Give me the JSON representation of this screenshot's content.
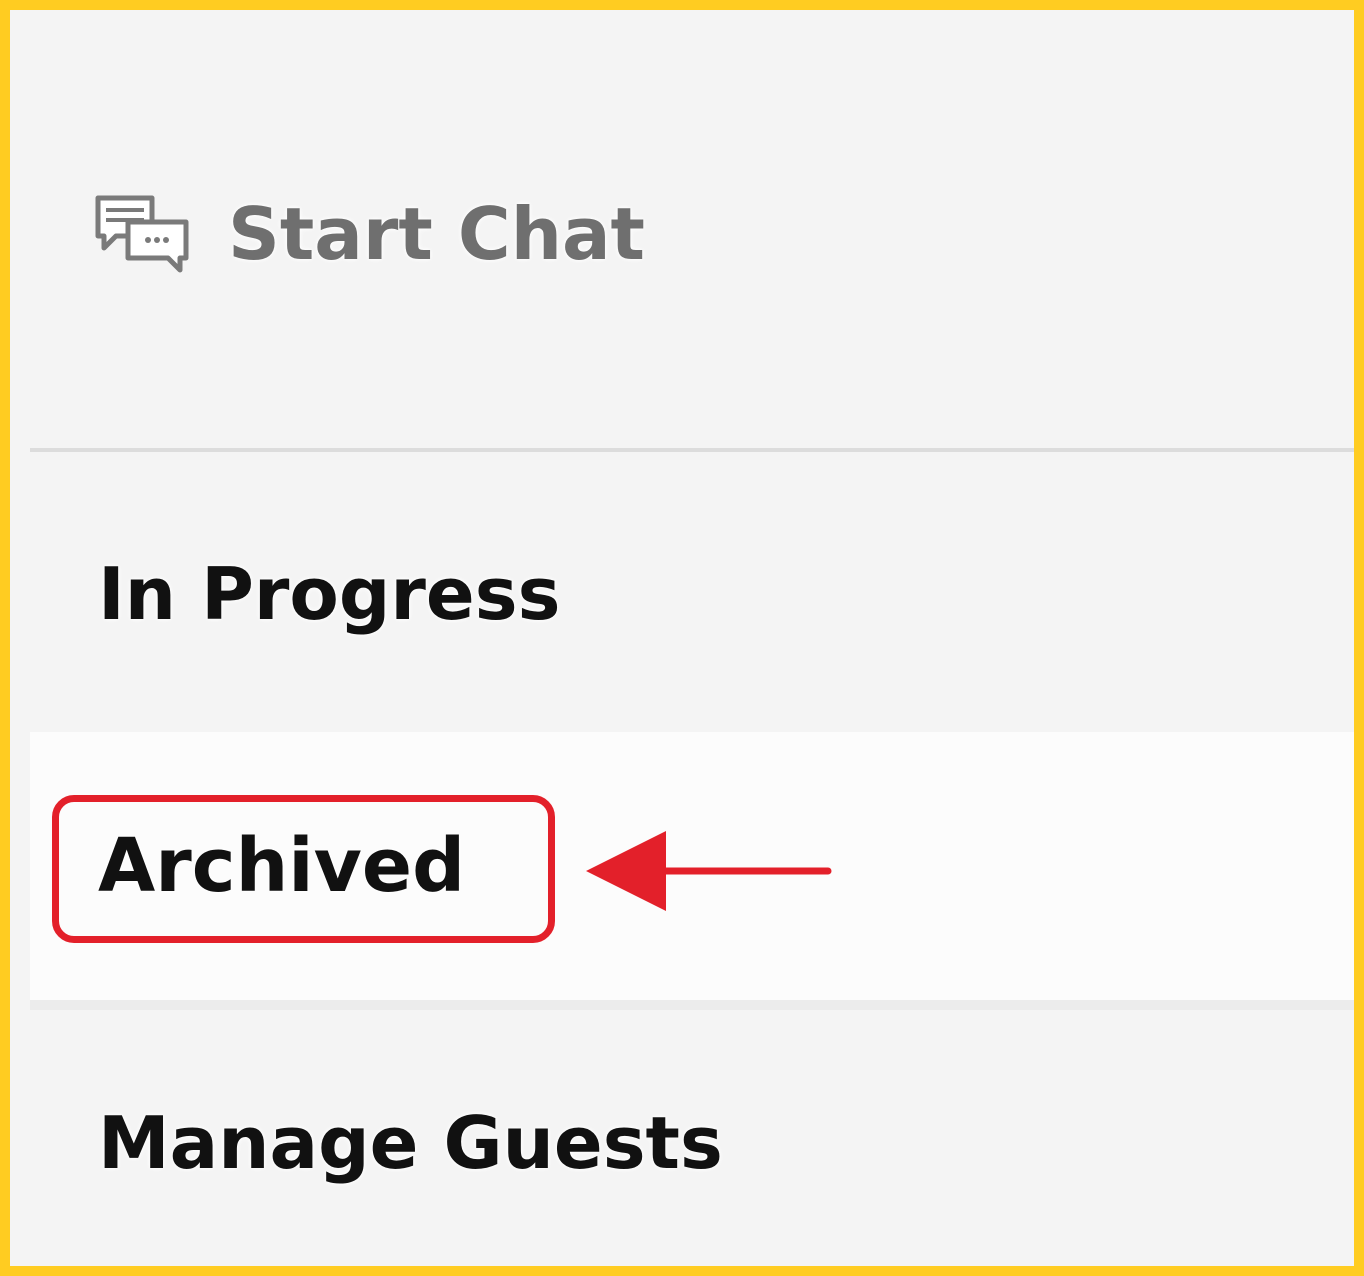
{
  "menu": {
    "items": [
      {
        "label": "Start Chat",
        "icon": "chat-bubbles-icon"
      },
      {
        "label": "In Progress"
      },
      {
        "label": "Archived",
        "highlighted": true
      },
      {
        "label": "Manage Guests"
      }
    ]
  },
  "annotation": {
    "highlight_color": "#e3202a",
    "frame_color": "#ffcc21",
    "arrow_direction": "left"
  }
}
